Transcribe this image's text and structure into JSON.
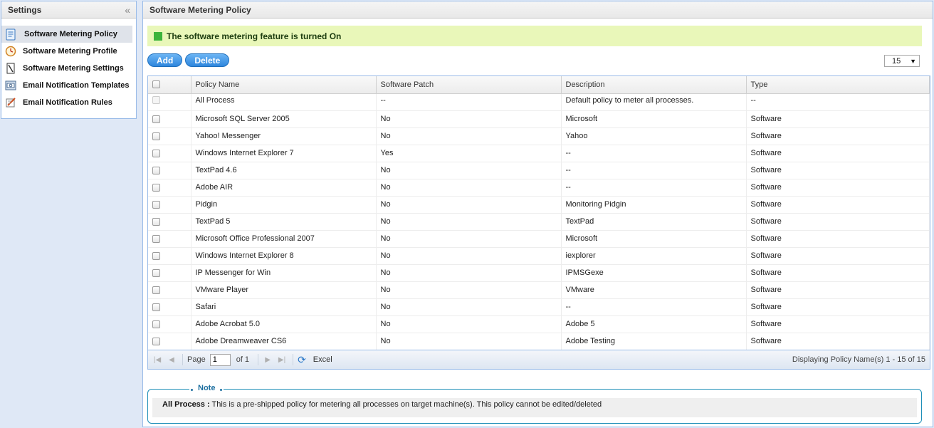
{
  "sidebar": {
    "title": "Settings",
    "items": [
      {
        "label": "Software Metering Policy",
        "icon": "policy-icon"
      },
      {
        "label": "Software Metering Profile",
        "icon": "clock-icon"
      },
      {
        "label": "Software Metering Settings",
        "icon": "settings-doc-icon"
      },
      {
        "label": "Email Notification Templates",
        "icon": "email-template-icon"
      },
      {
        "label": "Email Notification Rules",
        "icon": "rules-icon"
      }
    ]
  },
  "main": {
    "title": "Software Metering Policy",
    "status_text": "The software metering feature is turned On",
    "status_color": "#3cb43c",
    "toolbar": {
      "add_label": "Add",
      "delete_label": "Delete"
    },
    "page_size": "15",
    "columns": [
      "Policy Name",
      "Software Patch",
      "Description",
      "Type"
    ],
    "rows": [
      {
        "name": "All Process",
        "patch": "--",
        "description": "Default policy to meter all processes.",
        "type": "--"
      },
      {
        "name": "Microsoft SQL Server 2005",
        "patch": "No",
        "description": "Microsoft",
        "type": "Software"
      },
      {
        "name": "Yahoo! Messenger",
        "patch": "No",
        "description": "Yahoo",
        "type": "Software"
      },
      {
        "name": "Windows Internet Explorer 7",
        "patch": "Yes",
        "description": "--",
        "type": "Software"
      },
      {
        "name": "TextPad 4.6",
        "patch": "No",
        "description": "--",
        "type": "Software"
      },
      {
        "name": "Adobe AIR",
        "patch": "No",
        "description": "--",
        "type": "Software"
      },
      {
        "name": "Pidgin",
        "patch": "No",
        "description": "Monitoring Pidgin",
        "type": "Software"
      },
      {
        "name": "TextPad 5",
        "patch": "No",
        "description": "TextPad",
        "type": "Software"
      },
      {
        "name": "Microsoft Office Professional 2007",
        "patch": "No",
        "description": "Microsoft",
        "type": "Software"
      },
      {
        "name": "Windows Internet Explorer 8",
        "patch": "No",
        "description": "iexplorer",
        "type": "Software"
      },
      {
        "name": "IP Messenger for Win",
        "patch": "No",
        "description": "IPMSGexe",
        "type": "Software"
      },
      {
        "name": "VMware Player",
        "patch": "No",
        "description": "VMware",
        "type": "Software"
      },
      {
        "name": "Safari",
        "patch": "No",
        "description": "--",
        "type": "Software"
      },
      {
        "name": "Adobe Acrobat 5.0",
        "patch": "No",
        "description": "Adobe 5",
        "type": "Software"
      },
      {
        "name": "Adobe Dreamweaver CS6",
        "patch": "No",
        "description": "Adobe Testing",
        "type": "Software"
      }
    ],
    "pager": {
      "page_label": "Page",
      "page_value": "1",
      "of_label": "of 1",
      "excel_label": "Excel",
      "display_info": "Displaying Policy Name(s) 1 - 15 of 15"
    },
    "note": {
      "legend": "Note",
      "bold": "All Process :",
      "text": " This is a pre-shipped policy for metering all processes on target machine(s). This policy cannot be edited/deleted"
    }
  }
}
